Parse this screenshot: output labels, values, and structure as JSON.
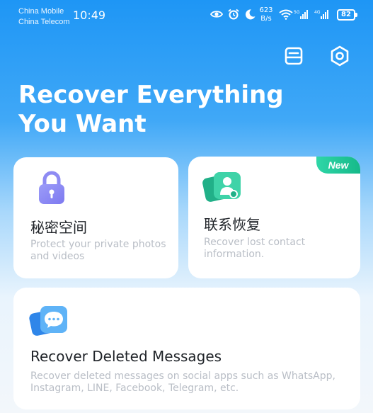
{
  "status_bar": {
    "carrier_1": "China Mobile",
    "carrier_2": "China Telecom",
    "time": "10:49",
    "speed_value": "623",
    "speed_unit": "B/s",
    "battery": "82",
    "icons": [
      "eye-icon",
      "alarm-icon",
      "moon-icon",
      "wifi-icon",
      "signal-5g-icon",
      "signal-4g-icon"
    ]
  },
  "header": {
    "title_line_1": "Recover Everything",
    "title_line_2": "You Want",
    "icons": [
      "history-icon",
      "settings-icon"
    ]
  },
  "cards": {
    "vault": {
      "title": "秘密空间",
      "description": "Protect your private photos and videos",
      "icon": "lock-icon"
    },
    "contacts": {
      "title": "联系恢复",
      "description": "Recover lost contact information.",
      "badge": "New",
      "icon": "contact-card-icon"
    },
    "messages": {
      "title": "Recover Deleted Messages",
      "description": "Recover deleted messages on social apps such as WhatsApp, Instagram, LINE, Facebook, Telegram, etc.",
      "icon": "chat-bubble-icon"
    }
  },
  "colors": {
    "header_blue": "#1e96f5",
    "new_badge_green": "#1fc79a",
    "vault_icon_purple": "#8b86f5",
    "contact_icon_teal": "#35c9a0",
    "message_icon_blue": "#4aa8f5"
  }
}
